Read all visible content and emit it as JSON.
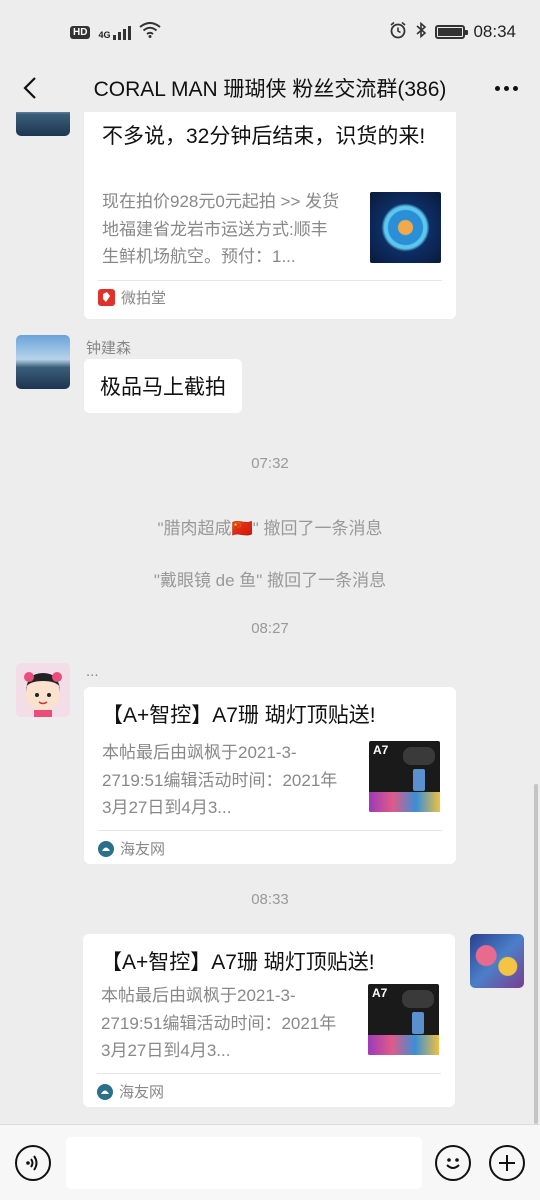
{
  "status_bar": {
    "hd": "HD",
    "network": "4G",
    "time": "08:34",
    "icons": [
      "signal-icon",
      "wifi-icon",
      "alarm-icon",
      "bluetooth-icon",
      "battery-icon"
    ]
  },
  "header": {
    "title": "CORAL MAN 珊瑚侠 粉丝交流群(386)"
  },
  "messages": {
    "m1": {
      "title": "不多说，32分钟后结束，识货的来!",
      "desc": "现在拍价928元0元起拍 >> 发货地福建省龙岩市运送方式:顺丰生鲜机场航空。预付：1...",
      "source": "微拍堂"
    },
    "m2": {
      "sender": "钟建森",
      "text": "极品马上截拍"
    },
    "ts1": "07:32",
    "recall1": "\"腊肉超咸🇨🇳\" 撤回了一条消息",
    "recall2": "\"戴眼镜 de 鱼\" 撤回了一条消息",
    "ts2": "08:27",
    "m3": {
      "sender": "...",
      "title": "【A+智控】A7珊 瑚灯顶贴送!",
      "desc": "本帖最后由飒枫于2021-3-2719:51编辑活动时间：2021年3月27日到4月3...",
      "source": "海友网",
      "thumb_label": "A7"
    },
    "ts3": "08:33",
    "m4": {
      "title": "【A+智控】A7珊 瑚灯顶贴送!",
      "desc": "本帖最后由飒枫于2021-3-2719:51编辑活动时间：2021年3月27日到4月3...",
      "source": "海友网",
      "thumb_label": "A7"
    }
  },
  "input": {
    "value": "",
    "placeholder": ""
  },
  "colors": {
    "background": "#ededed",
    "bubble": "#ffffff",
    "muted_text": "#888888",
    "weipai_red": "#e0322b",
    "haiyou_teal": "#2b6f8a"
  }
}
